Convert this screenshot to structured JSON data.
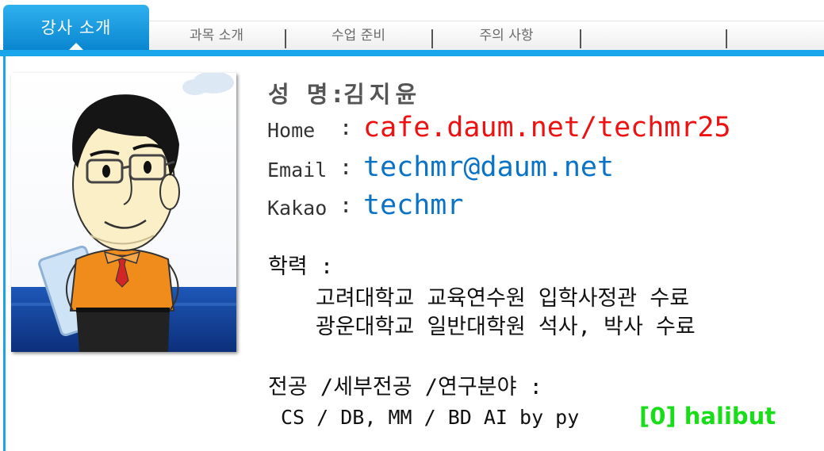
{
  "tabs": [
    {
      "label": "강사 소개",
      "active": true
    },
    {
      "label": "과목 소개",
      "active": false
    },
    {
      "label": "수업 준비",
      "active": false
    },
    {
      "label": "주의 사항",
      "active": false
    }
  ],
  "profile": {
    "name_label": "성 명",
    "name_sep": ":",
    "name_value": "김지윤",
    "home_label": "Home",
    "home_sep": ":",
    "home_value": "cafe.daum.net/techmr25",
    "email_label": "Email",
    "email_sep": ":",
    "email_value": "techmr@daum.net",
    "kakao_label": "Kakao",
    "kakao_sep": ":",
    "kakao_value": "techmr"
  },
  "education": {
    "heading": "학력 :",
    "items": [
      "고려대학교 교육연수원 입학사정관 수료",
      "광운대학교 일반대학원 석사, 박사 수료"
    ]
  },
  "major": {
    "heading": "전공 /세부전공 /연구분야 :",
    "value": "CS / DB, MM / BD AI by py"
  },
  "overlay_tag": "[0] halibut",
  "colors": {
    "accent": "#1aa4ea",
    "link_red": "#ee1111",
    "link_blue": "#0a73c6",
    "tag_green": "#19dd19"
  }
}
